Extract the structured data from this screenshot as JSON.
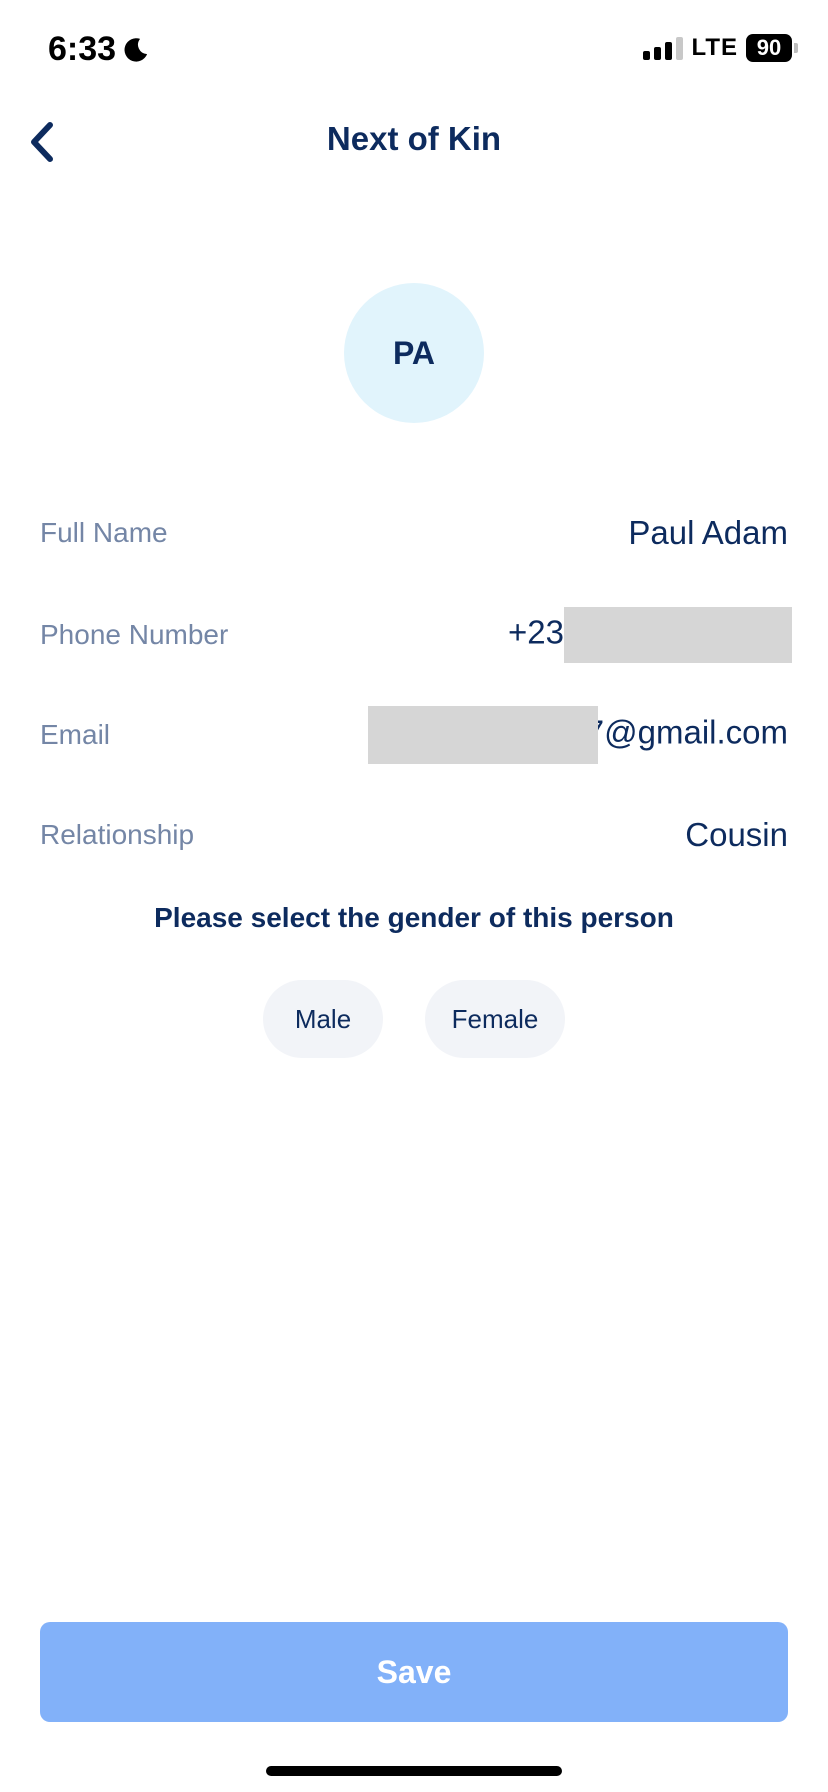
{
  "status_bar": {
    "time": "6:33",
    "network": "LTE",
    "battery": "90"
  },
  "nav": {
    "title": "Next of Kin"
  },
  "avatar": {
    "initials": "PA"
  },
  "fields": {
    "full_name": {
      "label": "Full Name",
      "value": "Paul Adam"
    },
    "phone": {
      "label": "Phone Number",
      "value_visible": "+23"
    },
    "email": {
      "label": "Email",
      "value_visible": "7@gmail.com"
    },
    "relationship": {
      "label": "Relationship",
      "value": "Cousin"
    }
  },
  "gender": {
    "prompt": "Please select the gender of this person",
    "options": [
      "Male",
      "Female"
    ]
  },
  "actions": {
    "save_label": "Save"
  },
  "colors": {
    "primary_text": "#0d2b5e",
    "label_text": "#7486a6",
    "avatar_bg": "#e1f4fc",
    "chip_bg": "#f2f4f8",
    "save_bg": "#82b1f9"
  }
}
